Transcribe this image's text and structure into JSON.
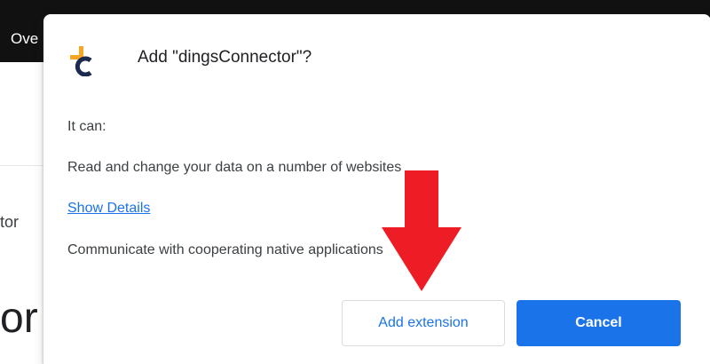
{
  "background": {
    "topbar_text": "Ove",
    "side_text": "tor",
    "heading_text": "or"
  },
  "dialog": {
    "icon": "dingsconnector-logo-icon",
    "title": "Add \"dingsConnector\"?",
    "intro": "It can:",
    "permission_1": "Read and change your data on a number of websites",
    "show_details": "Show Details",
    "permission_2": "Communicate with cooperating native applications",
    "add_button": "Add extension",
    "cancel_button": "Cancel"
  },
  "annotation": {
    "icon": "red-down-arrow-icon",
    "color": "#ee1c25"
  },
  "colors": {
    "accent": "#1a73e8",
    "logo_orange": "#f5a623",
    "logo_navy": "#1b2a4e"
  }
}
